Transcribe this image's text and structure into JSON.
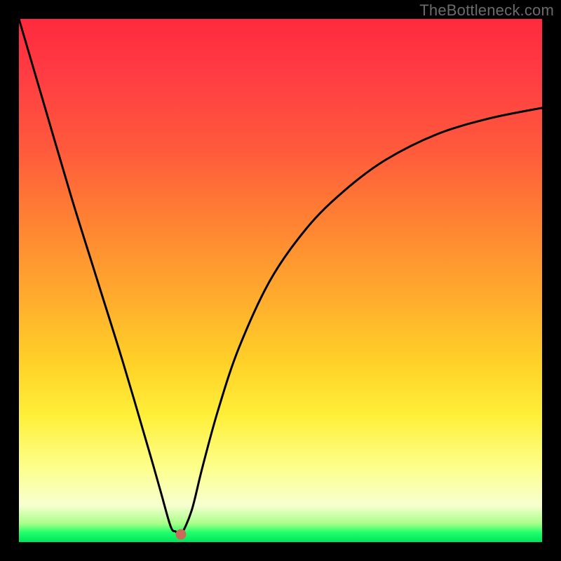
{
  "watermark": "TheBottleneck.com",
  "colors": {
    "frame": "#000000",
    "curve_stroke": "#000000",
    "dot_fill": "#cc6a5a",
    "gradient_stops": [
      "#ff2a3d",
      "#ff5a3c",
      "#ffa82e",
      "#fff03a",
      "#a6ff87",
      "#00e45e"
    ]
  },
  "chart_data": {
    "type": "line",
    "title": "",
    "xlabel": "",
    "ylabel": "",
    "xlim": [
      0,
      100
    ],
    "ylim": [
      0,
      100
    ],
    "grid": false,
    "legend": false,
    "annotations": [
      {
        "text": "TheBottleneck.com",
        "position": "top-right"
      }
    ],
    "marker": {
      "x": 31,
      "y": 1.5,
      "shape": "circle",
      "color": "#cc6a5a"
    },
    "series": [
      {
        "name": "bottleneck-curve",
        "x": [
          0,
          5,
          10,
          15,
          20,
          25,
          27,
          29,
          30,
          31,
          33,
          35,
          38,
          42,
          48,
          55,
          62,
          70,
          80,
          90,
          100
        ],
        "y": [
          100,
          83,
          66,
          50,
          34,
          17,
          10,
          3,
          2,
          1.5,
          6,
          14,
          25,
          37,
          50,
          60,
          67,
          73,
          78,
          81,
          83
        ]
      }
    ],
    "notes": "Values are approximate readings from the image. Axes have no tick labels; 0–100 scale assumed for both axes. y=0 is the bottom green edge, y=100 is the top red edge."
  }
}
